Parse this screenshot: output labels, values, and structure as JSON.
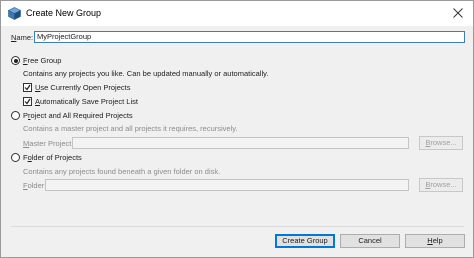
{
  "window": {
    "title": "Create New Group",
    "icon": "cube-app-icon",
    "close_icon": "close-icon"
  },
  "name": {
    "label_mn": "N",
    "label_rest": "ame:",
    "value": "MyProjectGroup"
  },
  "free_group": {
    "selected": true,
    "label_mn": "F",
    "label_rest": "ree Group",
    "description": "Contains any projects you like. Can be updated manually or automatically.",
    "use_open_projects": {
      "checked": true,
      "label_mn": "U",
      "label_rest": "se Currently Open Projects"
    },
    "auto_save_list": {
      "checked": true,
      "label_mn": "A",
      "label_rest": "utomatically Save Project List"
    }
  },
  "project_required": {
    "selected": false,
    "label_pre": "P",
    "label_mn": "r",
    "label_rest": "oject and All Required Projects",
    "description": "Contains a master project and all projects it requires, recursively.",
    "master_label_mn": "M",
    "master_label_rest": "aster Project:",
    "master_value": "",
    "browse_label_mn": "B",
    "browse_label_rest": "rowse..."
  },
  "folder": {
    "selected": false,
    "label_pre": "F",
    "label_mn": "o",
    "label_rest": "lder of Projects",
    "description": "Contains any projects found beneath a given folder on disk.",
    "folder_label_mn": "F",
    "folder_label_rest": "older:",
    "folder_value": "",
    "browse_label_mn": "B",
    "browse_label_rest": "rowse..."
  },
  "buttons": {
    "create": "Create Group",
    "cancel": "Cancel",
    "help_mn": "H",
    "help_rest": "elp"
  }
}
